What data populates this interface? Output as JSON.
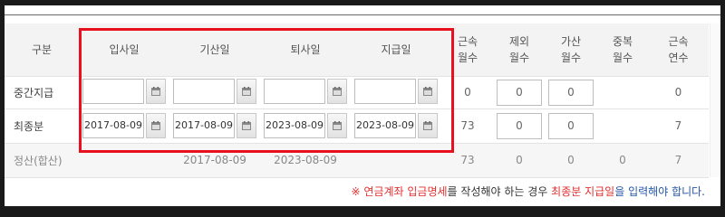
{
  "headers": {
    "category": "구분",
    "entry_date": "입사일",
    "base_date": "기산일",
    "exit_date": "퇴사일",
    "pay_date": "지급일",
    "service_months": [
      "근속",
      "월수"
    ],
    "excluded_months": [
      "제외",
      "월수"
    ],
    "added_months": [
      "가산",
      "월수"
    ],
    "duplicate_months": [
      "중복",
      "월수"
    ],
    "service_years": [
      "근속",
      "연수"
    ]
  },
  "rows": {
    "interim": {
      "label": "중간지급",
      "entry_date": "",
      "base_date": "",
      "exit_date": "",
      "pay_date": "",
      "service_months": "0",
      "excluded_months": "0",
      "added_months": "0",
      "duplicate_months": "",
      "service_years": "0"
    },
    "final": {
      "label": "최종분",
      "entry_date": "2017-08-09",
      "base_date": "2017-08-09",
      "exit_date": "2023-08-09",
      "pay_date": "2023-08-09",
      "service_months": "73",
      "excluded_months": "0",
      "added_months": "0",
      "duplicate_months": "",
      "service_years": "7"
    },
    "settlement": {
      "label": "정산(합산)",
      "base_date": "2017-08-09",
      "exit_date": "2023-08-09",
      "service_months": "73",
      "excluded_months": "0",
      "added_months": "0",
      "duplicate_months": "0",
      "service_years": "7"
    }
  },
  "notice": {
    "mark": "※",
    "part1": "연금계좌 입금명세",
    "part2": "를 작성해야 하는 경우 ",
    "part3": "최종분 지급일",
    "part4": "을 입력해야 합니다."
  },
  "icons": {
    "calendar": "calendar-icon"
  },
  "colors": {
    "highlight_box": "#e8101e",
    "notice_red": "#e23030",
    "notice_blue": "#2355a8"
  }
}
